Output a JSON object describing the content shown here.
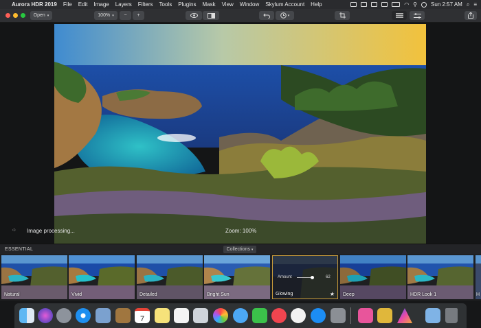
{
  "menubar": {
    "app": "Aurora HDR 2019",
    "items": [
      "File",
      "Edit",
      "Image",
      "Layers",
      "Filters",
      "Tools",
      "Plugins",
      "Mask",
      "View",
      "Window",
      "Skylum Account",
      "Help"
    ],
    "clock": "Sun 2:57 AM"
  },
  "toolbar": {
    "open_label": "Open",
    "zoom_value": "100%",
    "zoom_out": "−",
    "zoom_in": "+"
  },
  "canvas": {
    "status": "Image processing...",
    "zoom_status": "Zoom: 100%"
  },
  "essentials": {
    "title": "ESSENTIAL",
    "collections_label": "Collections",
    "looks": [
      {
        "name": "Natural"
      },
      {
        "name": "Vivid"
      },
      {
        "name": "Detailed"
      },
      {
        "name": "Bright Sun"
      },
      {
        "name": "Glowing",
        "selected": true,
        "amount_label": "Amount",
        "amount": "62"
      },
      {
        "name": "Deep"
      },
      {
        "name": "HDR Look 1"
      },
      {
        "name": "H"
      }
    ]
  },
  "dock": {
    "calendar_day": "7"
  },
  "colors": {
    "accent_selected": "#c79a3a",
    "background": "#1b1c1e"
  }
}
